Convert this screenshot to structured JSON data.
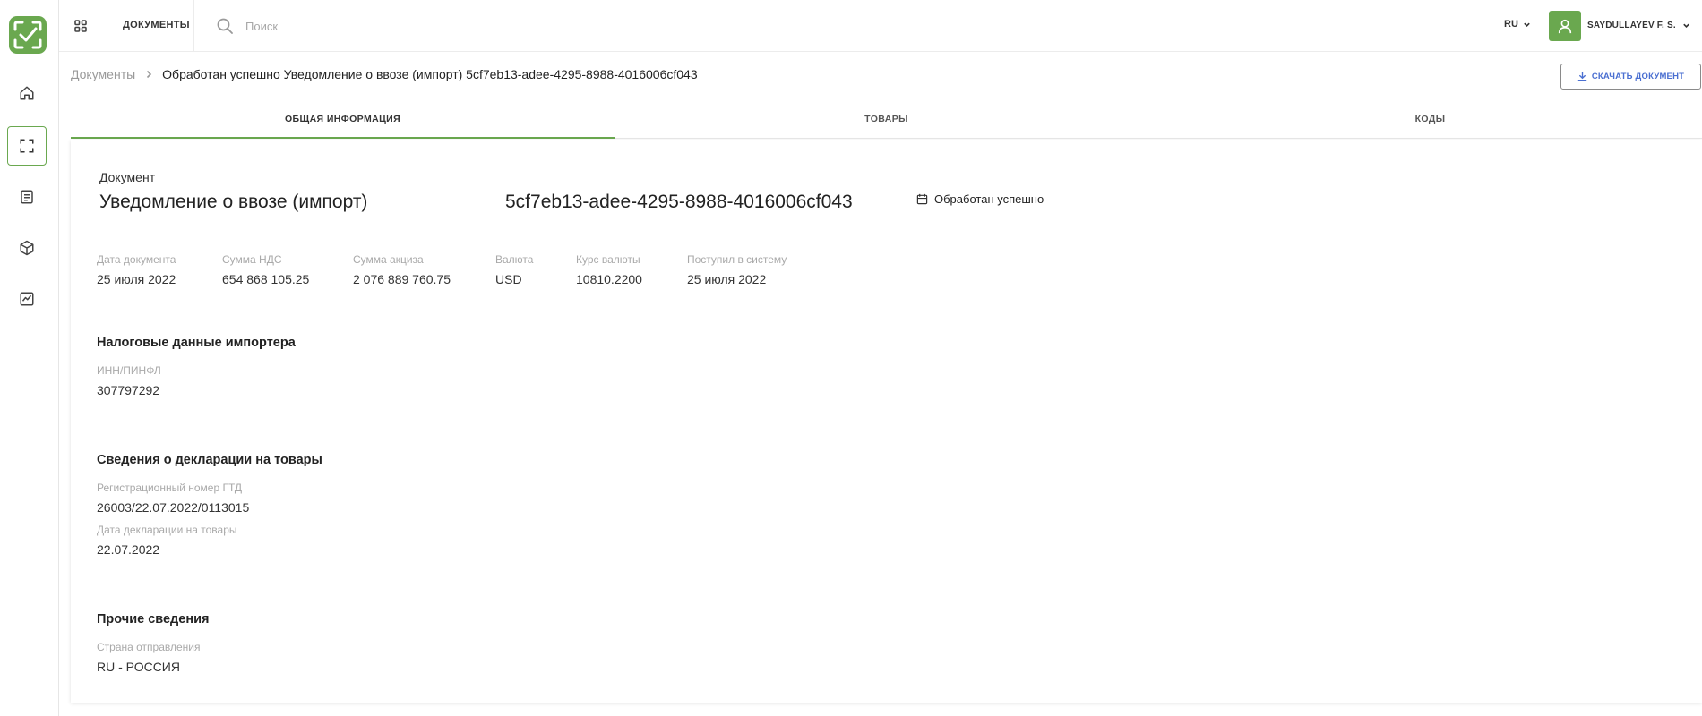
{
  "topbar": {
    "title": "ДОКУМЕНТЫ",
    "search_placeholder": "Поиск",
    "language": "RU",
    "user_name": "SAYDULLAYEV F. S."
  },
  "breadcrumb": {
    "root": "Документы",
    "current": "Обработан успешно Уведомление о ввозе (импорт) 5cf7eb13-adee-4295-8988-4016006cf043"
  },
  "actions": {
    "download_label": "СКАЧАТЬ ДОКУМЕНТ"
  },
  "tabs": [
    {
      "label": "ОБЩАЯ ИНФОРМАЦИЯ",
      "active": true
    },
    {
      "label": "ТОВАРЫ",
      "active": false
    },
    {
      "label": "КОДЫ",
      "active": false
    }
  ],
  "document": {
    "label": "Документ",
    "name": "Уведомление о ввозе (импорт)",
    "id": "5cf7eb13-adee-4295-8988-4016006cf043",
    "status": "Обработан успешно"
  },
  "summary": [
    {
      "label": "Дата документа",
      "value": "25 июля 2022"
    },
    {
      "label": "Сумма НДС",
      "value": "654 868 105.25"
    },
    {
      "label": "Сумма акциза",
      "value": "2 076 889 760.75"
    },
    {
      "label": "Валюта",
      "value": "USD"
    },
    {
      "label": "Курс валюты",
      "value": "10810.2200"
    },
    {
      "label": "Поступил в систему",
      "value": "25 июля 2022"
    }
  ],
  "sections": {
    "tax": {
      "title": "Налоговые данные импортера",
      "fields": [
        {
          "label": "ИНН/ПИНФЛ",
          "value": "307797292"
        }
      ]
    },
    "declaration": {
      "title": "Сведения о декларации на товары",
      "fields": [
        {
          "label": "Регистрационный номер ГТД",
          "value": "26003/22.07.2022/0113015"
        },
        {
          "label": "Дата декларации на товары",
          "value": "22.07.2022"
        }
      ]
    },
    "other": {
      "title": "Прочие сведения",
      "fields": [
        {
          "label": "Страна отправления",
          "value": "RU - РОССИЯ"
        }
      ]
    }
  },
  "colors": {
    "accent": "#6aa84f",
    "link_blue": "#4a6fd1"
  }
}
